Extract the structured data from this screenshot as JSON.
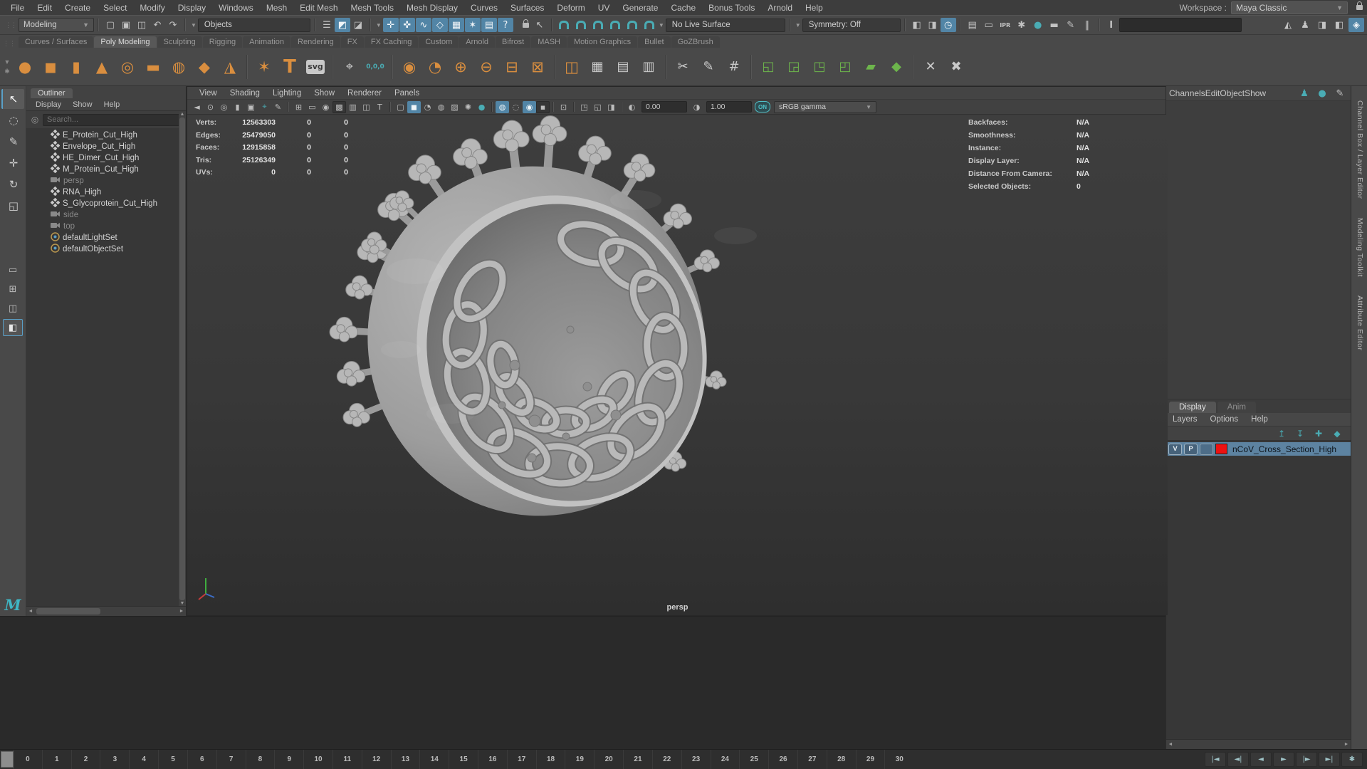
{
  "workspace": {
    "label": "Workspace :",
    "value": "Maya Classic"
  },
  "menu_bar": [
    "File",
    "Edit",
    "Create",
    "Select",
    "Modify",
    "Display",
    "Windows",
    "Mesh",
    "Edit Mesh",
    "Mesh Tools",
    "Mesh Display",
    "Curves",
    "Surfaces",
    "Deform",
    "UV",
    "Generate",
    "Cache",
    "Bonus Tools",
    "Arnold",
    "Help"
  ],
  "status_line": {
    "menuset": "Modeling",
    "mask_preset": "Objects",
    "live_surface": "No Live Surface",
    "symmetry": "Symmetry: Off",
    "file_icons": [
      {
        "name": "new-scene-icon",
        "glyph": "▢"
      },
      {
        "name": "open-scene-icon",
        "glyph": "▣"
      },
      {
        "name": "save-scene-icon",
        "glyph": "◫"
      },
      {
        "name": "undo-icon",
        "glyph": "↶"
      },
      {
        "name": "redo-icon",
        "glyph": "↷"
      }
    ],
    "mode_icons": [
      {
        "name": "select-by-hierarchy-icon",
        "glyph": "☰",
        "cls": ""
      },
      {
        "name": "select-by-object-icon",
        "glyph": "◩",
        "cls": "active"
      },
      {
        "name": "select-by-component-icon",
        "glyph": "◪",
        "cls": ""
      }
    ],
    "mask_icons": [
      {
        "name": "select-handles-icon",
        "glyph": "✛",
        "cls": "active"
      },
      {
        "name": "select-joints-icon",
        "glyph": "✜",
        "cls": "active"
      },
      {
        "name": "select-curves-icon",
        "glyph": "∿",
        "cls": "active"
      },
      {
        "name": "select-surfaces-icon",
        "glyph": "◇",
        "cls": "active"
      },
      {
        "name": "select-deformations-icon",
        "glyph": "▦",
        "cls": "active"
      },
      {
        "name": "select-dynamics-icon",
        "glyph": "✶",
        "cls": "active"
      },
      {
        "name": "select-rendering-icon",
        "glyph": "▤",
        "cls": "active"
      },
      {
        "name": "select-misc-icon",
        "glyph": "?",
        "cls": "active"
      }
    ],
    "lock_icons": [
      {
        "name": "lock-selection-icon",
        "shape": "lock"
      },
      {
        "name": "highlight-selection-icon",
        "glyph": "↖"
      }
    ],
    "snap_icons": [
      {
        "name": "snap-to-grid-icon",
        "shape": "magnet"
      },
      {
        "name": "snap-to-curve-icon",
        "shape": "magnet"
      },
      {
        "name": "snap-to-point-icon",
        "shape": "magnet"
      },
      {
        "name": "snap-to-projected-center-icon",
        "shape": "magnet"
      },
      {
        "name": "snap-to-view-plane-icon",
        "shape": "magnet"
      },
      {
        "name": "make-live-icon",
        "shape": "magnet"
      }
    ],
    "history_icons": [
      {
        "name": "input-connections-icon",
        "glyph": "◧",
        "cls": ""
      },
      {
        "name": "output-connections-icon",
        "glyph": "◨",
        "cls": ""
      },
      {
        "name": "construction-history-icon",
        "glyph": "◷",
        "cls": "active"
      }
    ],
    "render_icons": [
      {
        "name": "open-render-view-icon",
        "glyph": "▤",
        "cls": ""
      },
      {
        "name": "render-current-frame-icon",
        "glyph": "▭",
        "cls": ""
      },
      {
        "name": "ipr-render-icon",
        "glyph": "IPR",
        "cls": "tinytext"
      },
      {
        "name": "render-settings-icon",
        "glyph": "✱",
        "cls": ""
      },
      {
        "name": "arnold-render-icon",
        "glyph": "●",
        "cls": "teal"
      },
      {
        "name": "render-sequence-icon",
        "glyph": "▬",
        "cls": ""
      },
      {
        "name": "light-editor-icon",
        "glyph": "✎",
        "cls": ""
      },
      {
        "name": "pause-viewport-icon",
        "glyph": "‖",
        "cls": ""
      }
    ],
    "sidebar_icons": [
      {
        "name": "modeling-toolkit-sidebar-icon",
        "glyph": "◭",
        "cls": ""
      },
      {
        "name": "humanik-sidebar-icon",
        "glyph": "♟",
        "cls": ""
      },
      {
        "name": "attribute-editor-sidebar-icon",
        "glyph": "◨",
        "cls": ""
      },
      {
        "name": "tool-settings-sidebar-icon",
        "glyph": "◧",
        "cls": ""
      },
      {
        "name": "channel-box-sidebar-icon",
        "glyph": "◈",
        "cls": "active"
      }
    ]
  },
  "shelf": {
    "tabs": [
      {
        "label": "Curves / Surfaces",
        "active": false
      },
      {
        "label": "Poly Modeling",
        "active": true
      },
      {
        "label": "Sculpting",
        "active": false
      },
      {
        "label": "Rigging",
        "active": false
      },
      {
        "label": "Animation",
        "active": false
      },
      {
        "label": "Rendering",
        "active": false
      },
      {
        "label": "FX",
        "active": false
      },
      {
        "label": "FX Caching",
        "active": false
      },
      {
        "label": "Custom",
        "active": false
      },
      {
        "label": "Arnold",
        "active": false
      },
      {
        "label": "Bifrost",
        "active": false
      },
      {
        "label": "MASH",
        "active": false
      },
      {
        "label": "Motion Graphics",
        "active": false
      },
      {
        "label": "Bullet",
        "active": false
      },
      {
        "label": "GoZBrush",
        "active": false
      }
    ],
    "icons": [
      {
        "name": "poly-sphere-icon",
        "glyph": "●",
        "cls": "orange"
      },
      {
        "name": "poly-cube-icon",
        "glyph": "◼",
        "cls": "orange"
      },
      {
        "name": "poly-cylinder-icon",
        "glyph": "▮",
        "cls": "orange"
      },
      {
        "name": "poly-cone-icon",
        "glyph": "▲",
        "cls": "orange"
      },
      {
        "name": "poly-torus-icon",
        "glyph": "◎",
        "cls": "orange"
      },
      {
        "name": "poly-plane-icon",
        "glyph": "▬",
        "cls": "orange"
      },
      {
        "name": "poly-disc-icon",
        "glyph": "◍",
        "cls": "orange"
      },
      {
        "name": "platonic-solid-icon",
        "glyph": "◆",
        "cls": "orange"
      },
      {
        "name": "poly-pyramid-icon",
        "glyph": "◮",
        "cls": "orange"
      },
      {
        "sep": true
      },
      {
        "name": "sculpt-tool-icon",
        "glyph": "✶",
        "cls": "orange"
      },
      {
        "name": "type-tool-icon",
        "glyph": "T",
        "cls": "orange big"
      },
      {
        "name": "svg-tool-icon",
        "glyph": "svg",
        "cls": "badge"
      },
      {
        "sep": true
      },
      {
        "name": "snap-align-icon",
        "glyph": "⌖",
        "cls": "gray"
      },
      {
        "name": "move-to-origin-icon",
        "glyph": "0,0,0",
        "cls": "teal tiny"
      },
      {
        "sep": true
      },
      {
        "name": "smooth-mesh-icon",
        "glyph": "◉",
        "cls": "orange"
      },
      {
        "name": "subdivide-icon",
        "glyph": "◔",
        "cls": "orange"
      },
      {
        "name": "combine-icon",
        "glyph": "⊕",
        "cls": "orange"
      },
      {
        "name": "separate-icon",
        "glyph": "⊖",
        "cls": "orange"
      },
      {
        "name": "extract-icon",
        "glyph": "⊟",
        "cls": "orange"
      },
      {
        "name": "boolean-icon",
        "glyph": "⊠",
        "cls": "orange"
      },
      {
        "sep": true
      },
      {
        "name": "mirror-icon",
        "glyph": "◫",
        "cls": "orange"
      },
      {
        "name": "grid-fill-icon",
        "glyph": "▦",
        "cls": "gray"
      },
      {
        "name": "remesh-icon",
        "glyph": "▤",
        "cls": "gray"
      },
      {
        "name": "retopologize-icon",
        "glyph": "▥",
        "cls": "gray"
      },
      {
        "sep": true
      },
      {
        "name": "multi-cut-icon",
        "glyph": "✂",
        "cls": "gray"
      },
      {
        "name": "quad-draw-icon",
        "glyph": "✎",
        "cls": "gray"
      },
      {
        "name": "crease-tool-icon",
        "glyph": "#",
        "cls": "gray"
      },
      {
        "sep": true
      },
      {
        "name": "extrude-icon",
        "glyph": "◱",
        "cls": "green"
      },
      {
        "name": "bevel-icon",
        "glyph": "◲",
        "cls": "green"
      },
      {
        "name": "bridge-icon",
        "glyph": "◳",
        "cls": "green"
      },
      {
        "name": "fill-hole-icon",
        "glyph": "◰",
        "cls": "green"
      },
      {
        "name": "append-polygon-icon",
        "glyph": "▰",
        "cls": "green"
      },
      {
        "name": "wedge-icon",
        "glyph": "◆",
        "cls": "green"
      },
      {
        "sep": true
      },
      {
        "name": "target-weld-icon",
        "glyph": "✕",
        "cls": "gray"
      },
      {
        "name": "delete-component-icon",
        "glyph": "✖",
        "cls": "gray"
      }
    ]
  },
  "toolbox": {
    "tools": [
      {
        "name": "select-tool-icon",
        "glyph": "↖",
        "cls": "active"
      },
      {
        "name": "lasso-select-icon",
        "glyph": "◌",
        "cls": ""
      },
      {
        "name": "paint-select-icon",
        "glyph": "✎",
        "cls": ""
      },
      {
        "name": "move-tool-icon",
        "glyph": "✛",
        "cls": ""
      },
      {
        "name": "rotate-tool-icon",
        "glyph": "↻",
        "cls": ""
      },
      {
        "name": "scale-tool-icon",
        "glyph": "◱",
        "cls": ""
      }
    ],
    "layouts": [
      {
        "name": "single-pane-layout-icon",
        "glyph": "▭",
        "cls": ""
      },
      {
        "name": "four-pane-layout-icon",
        "glyph": "⊞",
        "cls": ""
      },
      {
        "name": "two-pane-layout-icon",
        "glyph": "◫",
        "cls": ""
      },
      {
        "name": "outliner-persp-layout-icon",
        "glyph": "◧",
        "cls": "active"
      }
    ]
  },
  "outliner": {
    "title": "Outliner",
    "menus": [
      "Display",
      "Show",
      "Help"
    ],
    "search_placeholder": "Search...",
    "items": [
      {
        "label": "E_Protein_Cut_High",
        "type": "mesh",
        "dim": false
      },
      {
        "label": "Envelope_Cut_High",
        "type": "mesh",
        "dim": false
      },
      {
        "label": "HE_Dimer_Cut_High",
        "type": "mesh",
        "dim": false
      },
      {
        "label": "M_Protein_Cut_High",
        "type": "mesh",
        "dim": false
      },
      {
        "label": "persp",
        "type": "camera",
        "dim": true
      },
      {
        "label": "RNA_High",
        "type": "mesh",
        "dim": false
      },
      {
        "label": "S_Glycoprotein_Cut_High",
        "type": "mesh",
        "dim": false
      },
      {
        "label": "side",
        "type": "camera",
        "dim": true
      },
      {
        "label": "top",
        "type": "camera",
        "dim": true
      },
      {
        "label": "defaultLightSet",
        "type": "set",
        "dim": false
      },
      {
        "label": "defaultObjectSet",
        "type": "set",
        "dim": false
      }
    ]
  },
  "viewport": {
    "menus": [
      "View",
      "Shading",
      "Lighting",
      "Show",
      "Renderer",
      "Panels"
    ],
    "toolbar_icons": [
      {
        "name": "camera-select-icon",
        "glyph": "◄",
        "cls": ""
      },
      {
        "name": "lock-camera-icon",
        "glyph": "⊙",
        "cls": ""
      },
      {
        "name": "camera-attributes-icon",
        "glyph": "◎",
        "cls": ""
      },
      {
        "name": "bookmark-icon",
        "glyph": "▮",
        "cls": ""
      },
      {
        "name": "image-plane-icon",
        "glyph": "▣",
        "cls": ""
      },
      {
        "name": "two-d-pan-zoom-icon",
        "glyph": "⌖",
        "cls": "teal"
      },
      {
        "name": "grease-pencil-icon",
        "glyph": "✎",
        "cls": ""
      },
      {
        "sep": true
      },
      {
        "name": "grid-icon",
        "glyph": "⊞",
        "cls": ""
      },
      {
        "name": "film-gate-icon",
        "glyph": "▭",
        "cls": ""
      },
      {
        "name": "resolution-gate-icon",
        "glyph": "◉",
        "cls": ""
      },
      {
        "name": "gate-mask-icon",
        "glyph": "▩",
        "cls": "pressed"
      },
      {
        "name": "field-chart-icon",
        "glyph": "▥",
        "cls": ""
      },
      {
        "name": "safe-action-icon",
        "glyph": "◫",
        "cls": ""
      },
      {
        "name": "safe-title-icon",
        "glyph": "T",
        "cls": ""
      },
      {
        "sep": true
      },
      {
        "name": "wireframe-icon",
        "glyph": "▢",
        "cls": ""
      },
      {
        "name": "smooth-shade-icon",
        "glyph": "◼",
        "cls": "active"
      },
      {
        "name": "use-default-material-icon",
        "glyph": "◔",
        "cls": ""
      },
      {
        "name": "textured-icon",
        "glyph": "◍",
        "cls": ""
      },
      {
        "name": "wireframe-on-shaded-icon",
        "glyph": "▨",
        "cls": ""
      },
      {
        "name": "lighting-icon",
        "glyph": "✺",
        "cls": ""
      },
      {
        "name": "shadows-icon",
        "glyph": "●",
        "cls": "teal"
      },
      {
        "sep": true
      },
      {
        "name": "screen-space-ao-icon",
        "glyph": "◍",
        "cls": "active"
      },
      {
        "name": "motion-blur-icon",
        "glyph": "◌",
        "cls": ""
      },
      {
        "name": "anti-aliasing-icon",
        "glyph": "◉",
        "cls": "active"
      },
      {
        "name": "depth-of-field-icon",
        "glyph": "▪",
        "cls": "pressed"
      },
      {
        "sep": true
      },
      {
        "name": "isolate-select-icon",
        "glyph": "⊡",
        "cls": ""
      },
      {
        "sep": true
      },
      {
        "name": "paste-pose-icon",
        "glyph": "◳",
        "cls": ""
      },
      {
        "name": "copy-pose-icon",
        "glyph": "◱",
        "cls": ""
      },
      {
        "name": "snapshot-icon",
        "glyph": "◨",
        "cls": ""
      },
      {
        "sep": true
      },
      {
        "name": "exposure-icon",
        "glyph": "◐",
        "cls": ""
      }
    ],
    "exposure": "0.00",
    "gamma": "1.00",
    "on_badge": "ON",
    "colorspace": "sRGB gamma",
    "camera_label": "persp",
    "hud_left": [
      {
        "label": "Verts:",
        "values": [
          "12563303",
          "0",
          "0"
        ]
      },
      {
        "label": "Edges:",
        "values": [
          "25479050",
          "0",
          "0"
        ]
      },
      {
        "label": "Faces:",
        "values": [
          "12915858",
          "0",
          "0"
        ]
      },
      {
        "label": "Tris:",
        "values": [
          "25126349",
          "0",
          "0"
        ]
      },
      {
        "label": "UVs:",
        "values": [
          "0",
          "0",
          "0"
        ]
      }
    ],
    "hud_right": [
      {
        "label": "Backfaces:",
        "value": "N/A"
      },
      {
        "label": "Smoothness:",
        "value": "N/A"
      },
      {
        "label": "Instance:",
        "value": "N/A"
      },
      {
        "label": "Display Layer:",
        "value": "N/A"
      },
      {
        "label": "Distance From Camera:",
        "value": "N/A"
      },
      {
        "label": "Selected Objects:",
        "value": "0"
      }
    ]
  },
  "channel_box": {
    "menus": [
      "Channels",
      "Edit",
      "Object",
      "Show"
    ],
    "option_icons": [
      {
        "name": "channel-manipulator-icon",
        "glyph": "♟",
        "cls": "teal"
      },
      {
        "name": "channel-speed-icon",
        "glyph": "●",
        "cls": "teal"
      },
      {
        "name": "channel-pencil-icon",
        "glyph": "✎",
        "cls": ""
      }
    ]
  },
  "layer_editor": {
    "tabs": [
      {
        "label": "Display",
        "active": true
      },
      {
        "label": "Anim",
        "active": false
      }
    ],
    "menus": [
      "Layers",
      "Options",
      "Help"
    ],
    "icons": [
      {
        "name": "layer-move-up-icon",
        "glyph": "↥",
        "cls": "teal"
      },
      {
        "name": "layer-move-down-icon",
        "glyph": "↧",
        "cls": "teal"
      },
      {
        "name": "new-empty-layer-icon",
        "glyph": "✚",
        "cls": "teal"
      },
      {
        "name": "new-layer-from-selected-icon",
        "glyph": "◆",
        "cls": "teal"
      }
    ],
    "layers": [
      {
        "visible": "V",
        "playback": "P",
        "name": "nCoV_Cross_Section_High",
        "color": "#ee1111",
        "selected": true
      }
    ]
  },
  "side_strip": {
    "labels": [
      "Channel Box / Layer Editor",
      "Modeling Toolkit",
      "Attribute Editor"
    ]
  },
  "time_slider": {
    "frames": [
      "0",
      "1",
      "2",
      "3",
      "4",
      "5",
      "6",
      "7",
      "8",
      "9",
      "10",
      "11",
      "12",
      "13",
      "14",
      "15",
      "16",
      "17",
      "18",
      "19",
      "20",
      "21",
      "22",
      "23",
      "24",
      "25",
      "26",
      "27",
      "28",
      "29",
      "30"
    ],
    "playback_icons": [
      {
        "name": "go-to-start-icon",
        "glyph": "|◄"
      },
      {
        "name": "step-back-frame-icon",
        "glyph": "◄|"
      },
      {
        "name": "play-backwards-icon",
        "glyph": "◄"
      },
      {
        "name": "play-forwards-icon",
        "glyph": "►"
      },
      {
        "name": "step-forward-frame-icon",
        "glyph": "|►"
      },
      {
        "name": "go-to-end-icon",
        "glyph": "►|"
      },
      {
        "name": "anim-preferences-icon",
        "glyph": "✱"
      }
    ]
  },
  "colors": {
    "accent_blue": "#5285a6",
    "icon_teal": "#4aacb4",
    "shelf_orange": "#d98e3f",
    "layer_red": "#ee1111",
    "selected_row_blue": "#5d83a1"
  }
}
